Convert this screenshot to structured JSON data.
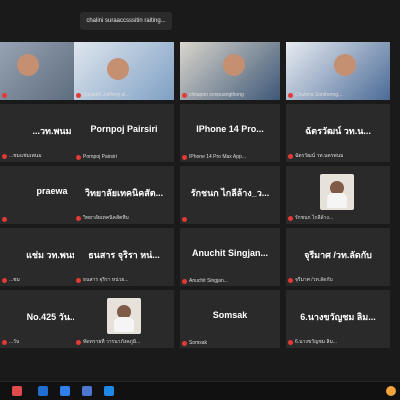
{
  "top_bar": {
    "notice": "chalini suraaccsssitin raiting..."
  },
  "participants": [
    {
      "label": "",
      "display": ""
    },
    {
      "label": "Sauitath Jaithing ol...",
      "display": ""
    },
    {
      "label": "chitapon sonpuangthong",
      "display": ""
    },
    {
      "label": "Chutima Sontherng...",
      "display": ""
    },
    {
      "name": "...วท.พนม",
      "label": "...ชมแช่มเพนม"
    },
    {
      "name": "Pornpoj Pairsiri",
      "label": "Pornpoj Pairsiri"
    },
    {
      "name": "IPhone 14 Pro...",
      "label": "IPhone 14 Pro Max App..."
    },
    {
      "name": "ฉัตรวัฒน์ วท.น...",
      "label": "ฉัตรวัฒน์ วท.นครพนม"
    },
    {
      "name": "praewa",
      "label": ""
    },
    {
      "name": "วิทยาลัยเทคนิคสัต...",
      "label": "วิทยาลัยเทคนิคสัตหีบ"
    },
    {
      "name": "รักชนก ไกลีล้าง_ว...",
      "label": ""
    },
    {
      "label": "รักชนก ไกลีล้าง..."
    },
    {
      "name": "แช่ม วท.พนม",
      "label": "...ชม"
    },
    {
      "name": "ธนสาร จุริรา หน่...",
      "label": "ธนสาร จุริรา หน่วย..."
    },
    {
      "name": "Anuchit Singjan...",
      "label": "Anuchit Singjan..."
    },
    {
      "name": "จุรีมาศ /วท.ลัดกับ",
      "label": "จุรีมาศ /วท.ลัดกับ"
    },
    {
      "name": "No.425 วัน...",
      "label": "...วัน"
    },
    {
      "label": "ทัดทรายที วารนาภังคภูมิ..."
    },
    {
      "name": "Somsak",
      "label": "Somsak"
    },
    {
      "name": "6.นางขวัญชม ลิม...",
      "label": "6.นางขวัญชม ลิม..."
    }
  ]
}
